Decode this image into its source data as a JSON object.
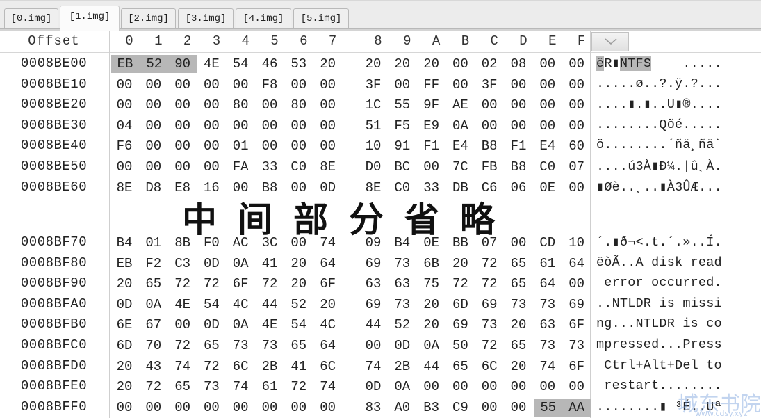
{
  "tabs": [
    {
      "label": "[0.img]",
      "active": false
    },
    {
      "label": "[1.img]",
      "active": true
    },
    {
      "label": "[2.img]",
      "active": false
    },
    {
      "label": "[3.img]",
      "active": false
    },
    {
      "label": "[4.img]",
      "active": false
    },
    {
      "label": "[5.img]",
      "active": false
    }
  ],
  "header": {
    "offset_label": "Offset",
    "columns": [
      "0",
      "1",
      "2",
      "3",
      "4",
      "5",
      "6",
      "7",
      "8",
      "9",
      "A",
      "B",
      "C",
      "D",
      "E",
      "F"
    ],
    "dropdown_icon": "chevron-down-icon"
  },
  "top_rows": [
    {
      "offset": "0008BE00",
      "bytes": [
        "EB",
        "52",
        "90",
        "4E",
        "54",
        "46",
        "53",
        "20",
        "20",
        "20",
        "20",
        "00",
        "02",
        "08",
        "00",
        "00"
      ],
      "ascii": "ëR▮NTFS    .....",
      "selected": [
        0,
        1,
        2
      ]
    },
    {
      "offset": "0008BE10",
      "bytes": [
        "00",
        "00",
        "00",
        "00",
        "00",
        "F8",
        "00",
        "00",
        "3F",
        "00",
        "FF",
        "00",
        "3F",
        "00",
        "00",
        "00"
      ],
      "ascii": ".....ø..?.ÿ.?...",
      "selected": []
    },
    {
      "offset": "0008BE20",
      "bytes": [
        "00",
        "00",
        "00",
        "00",
        "80",
        "00",
        "80",
        "00",
        "1C",
        "55",
        "9F",
        "AE",
        "00",
        "00",
        "00",
        "00"
      ],
      "ascii": "....▮.▮..U▮®....",
      "selected": []
    },
    {
      "offset": "0008BE30",
      "bytes": [
        "04",
        "00",
        "00",
        "00",
        "00",
        "00",
        "00",
        "00",
        "51",
        "F5",
        "E9",
        "0A",
        "00",
        "00",
        "00",
        "00"
      ],
      "ascii": "........Qõé.....",
      "selected": []
    },
    {
      "offset": "0008BE40",
      "bytes": [
        "F6",
        "00",
        "00",
        "00",
        "01",
        "00",
        "00",
        "00",
        "10",
        "91",
        "F1",
        "E4",
        "B8",
        "F1",
        "E4",
        "60"
      ],
      "ascii": "ö........´ñä¸ñä`",
      "selected": []
    },
    {
      "offset": "0008BE50",
      "bytes": [
        "00",
        "00",
        "00",
        "00",
        "FA",
        "33",
        "C0",
        "8E",
        "D0",
        "BC",
        "00",
        "7C",
        "FB",
        "B8",
        "C0",
        "07"
      ],
      "ascii": "....ú3À▮Ð¼.|û¸À.",
      "selected": []
    },
    {
      "offset": "0008BE60",
      "bytes": [
        "8E",
        "D8",
        "E8",
        "16",
        "00",
        "B8",
        "00",
        "0D",
        "8E",
        "C0",
        "33",
        "DB",
        "C6",
        "06",
        "0E",
        "00"
      ],
      "ascii": "▮Øè..¸..▮À3ÛÆ...",
      "selected": []
    }
  ],
  "omitted_note": "中间部分省略",
  "bottom_rows": [
    {
      "offset": "0008BF70",
      "bytes": [
        "B4",
        "01",
        "8B",
        "F0",
        "AC",
        "3C",
        "00",
        "74",
        "09",
        "B4",
        "0E",
        "BB",
        "07",
        "00",
        "CD",
        "10"
      ],
      "ascii": "´.▮ð¬<.t.´.»..Í.",
      "selected": []
    },
    {
      "offset": "0008BF80",
      "bytes": [
        "EB",
        "F2",
        "C3",
        "0D",
        "0A",
        "41",
        "20",
        "64",
        "69",
        "73",
        "6B",
        "20",
        "72",
        "65",
        "61",
        "64"
      ],
      "ascii": "ëòÃ..A disk read",
      "selected": []
    },
    {
      "offset": "0008BF90",
      "bytes": [
        "20",
        "65",
        "72",
        "72",
        "6F",
        "72",
        "20",
        "6F",
        "63",
        "63",
        "75",
        "72",
        "72",
        "65",
        "64",
        "00"
      ],
      "ascii": " error occurred.",
      "selected": []
    },
    {
      "offset": "0008BFA0",
      "bytes": [
        "0D",
        "0A",
        "4E",
        "54",
        "4C",
        "44",
        "52",
        "20",
        "69",
        "73",
        "20",
        "6D",
        "69",
        "73",
        "73",
        "69"
      ],
      "ascii": "..NTLDR is missi",
      "selected": []
    },
    {
      "offset": "0008BFB0",
      "bytes": [
        "6E",
        "67",
        "00",
        "0D",
        "0A",
        "4E",
        "54",
        "4C",
        "44",
        "52",
        "20",
        "69",
        "73",
        "20",
        "63",
        "6F"
      ],
      "ascii": "ng...NTLDR is co",
      "selected": []
    },
    {
      "offset": "0008BFC0",
      "bytes": [
        "6D",
        "70",
        "72",
        "65",
        "73",
        "73",
        "65",
        "64",
        "00",
        "0D",
        "0A",
        "50",
        "72",
        "65",
        "73",
        "73"
      ],
      "ascii": "mpressed...Press",
      "selected": []
    },
    {
      "offset": "0008BFD0",
      "bytes": [
        "20",
        "43",
        "74",
        "72",
        "6C",
        "2B",
        "41",
        "6C",
        "74",
        "2B",
        "44",
        "65",
        "6C",
        "20",
        "74",
        "6F"
      ],
      "ascii": " Ctrl+Alt+Del to",
      "selected": []
    },
    {
      "offset": "0008BFE0",
      "bytes": [
        "20",
        "72",
        "65",
        "73",
        "74",
        "61",
        "72",
        "74",
        "0D",
        "0A",
        "00",
        "00",
        "00",
        "00",
        "00",
        "00"
      ],
      "ascii": " restart........",
      "selected": []
    },
    {
      "offset": "0008BFF0",
      "bytes": [
        "00",
        "00",
        "00",
        "00",
        "00",
        "00",
        "00",
        "00",
        "83",
        "A0",
        "B3",
        "C9",
        "00",
        "00",
        "55",
        "AA"
      ],
      "ascii": "........▮ ³É..Uª",
      "selected": [
        14,
        15
      ]
    }
  ],
  "watermark": {
    "text": "城东书院",
    "sub": "www.cdsy.xyz"
  },
  "colors": {
    "selection": "#b7b7b7",
    "tabbar": "#ececec"
  }
}
